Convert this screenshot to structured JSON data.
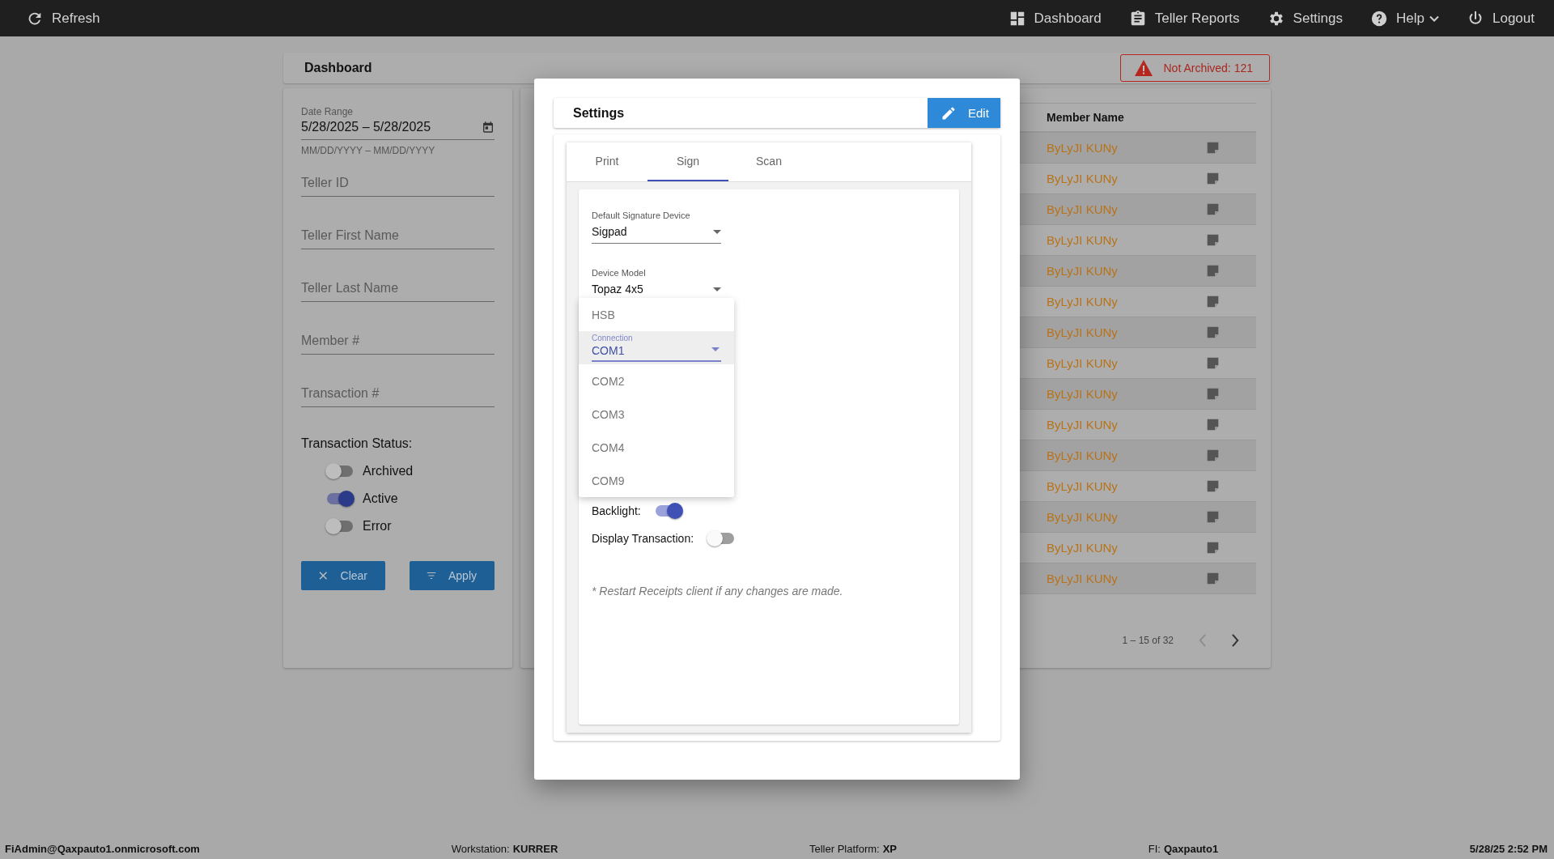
{
  "top_bar": {
    "refresh": "Refresh",
    "nav": [
      {
        "label": "Dashboard",
        "dropdown": false
      },
      {
        "label": "Teller Reports",
        "dropdown": false
      },
      {
        "label": "Settings",
        "dropdown": false
      },
      {
        "label": "Help",
        "dropdown": true
      },
      {
        "label": "Logout",
        "dropdown": false
      }
    ]
  },
  "page": {
    "title": "Dashboard",
    "alert": "Not Archived: 121"
  },
  "filters": {
    "date_range": {
      "label": "Date Range",
      "value": "5/28/2025 – 5/28/2025",
      "helper": "MM/DD/YYYY – MM/DD/YYYY"
    },
    "fields": [
      {
        "placeholder": "Teller ID"
      },
      {
        "placeholder": "Teller First Name"
      },
      {
        "placeholder": "Teller Last Name"
      },
      {
        "placeholder": "Member #"
      },
      {
        "placeholder": "Transaction #"
      }
    ],
    "status_label": "Transaction Status:",
    "statuses": [
      {
        "label": "Archived",
        "on": false
      },
      {
        "label": "Active",
        "on": true
      },
      {
        "label": "Error",
        "on": false
      }
    ],
    "buttons": [
      {
        "label": "Clear"
      },
      {
        "label": "Apply"
      }
    ]
  },
  "table": {
    "columns": [
      "Member Name"
    ],
    "rows": [
      {
        "member_name": "ByLyJI KUNy"
      },
      {
        "member_name": "ByLyJI KUNy"
      },
      {
        "member_name": "ByLyJI KUNy"
      },
      {
        "member_name": "ByLyJI KUNy"
      },
      {
        "member_name": "ByLyJI KUNy"
      },
      {
        "member_name": "ByLyJI KUNy"
      },
      {
        "member_name": "ByLyJI KUNy"
      },
      {
        "member_name": "ByLyJI KUNy"
      },
      {
        "member_name": "ByLyJI KUNy"
      },
      {
        "member_name": "ByLyJI KUNy"
      },
      {
        "member_name": "ByLyJI KUNy"
      },
      {
        "member_name": "ByLyJI KUNy"
      },
      {
        "member_name": "ByLyJI KUNy"
      },
      {
        "member_name": "ByLyJI KUNy"
      },
      {
        "member_name": "ByLyJI KUNy"
      }
    ],
    "pagination": "1 – 15 of 32",
    "prev": {
      "disabled": true
    },
    "next": {
      "disabled": false
    }
  },
  "modal": {
    "title": "Settings",
    "edit": "Edit",
    "tabs": [
      {
        "label": "Print",
        "selected": false
      },
      {
        "label": "Sign",
        "selected": true
      },
      {
        "label": "Scan",
        "selected": false
      }
    ],
    "fields": [
      {
        "label": "Default Signature Device",
        "value": "Sigpad"
      },
      {
        "label": "Device Model",
        "value": "Topaz 4x5"
      }
    ],
    "connection": {
      "label": "Connection",
      "options": [
        {
          "label": "HSB",
          "selected": false
        },
        {
          "label": "COM1",
          "selected": true
        },
        {
          "label": "COM2",
          "selected": false
        },
        {
          "label": "COM3",
          "selected": false
        },
        {
          "label": "COM4",
          "selected": false
        },
        {
          "label": "COM9",
          "selected": false
        }
      ]
    },
    "switches": [
      {
        "label": "Backlight:",
        "on": true
      },
      {
        "label": "Display Transaction:",
        "on": false
      }
    ],
    "note": "* Restart Receipts client if any changes are made."
  },
  "status_bar": [
    {
      "value": "FiAdmin@Qaxpauto1.onmicrosoft.com"
    },
    {
      "label": "Workstation:",
      "value": "KURRER"
    },
    {
      "label": "Teller Platform:",
      "value": "XP"
    },
    {
      "label": "FI:",
      "value": "Qaxpauto1"
    },
    {
      "value": "5/28/25 2:52 PM"
    }
  ]
}
